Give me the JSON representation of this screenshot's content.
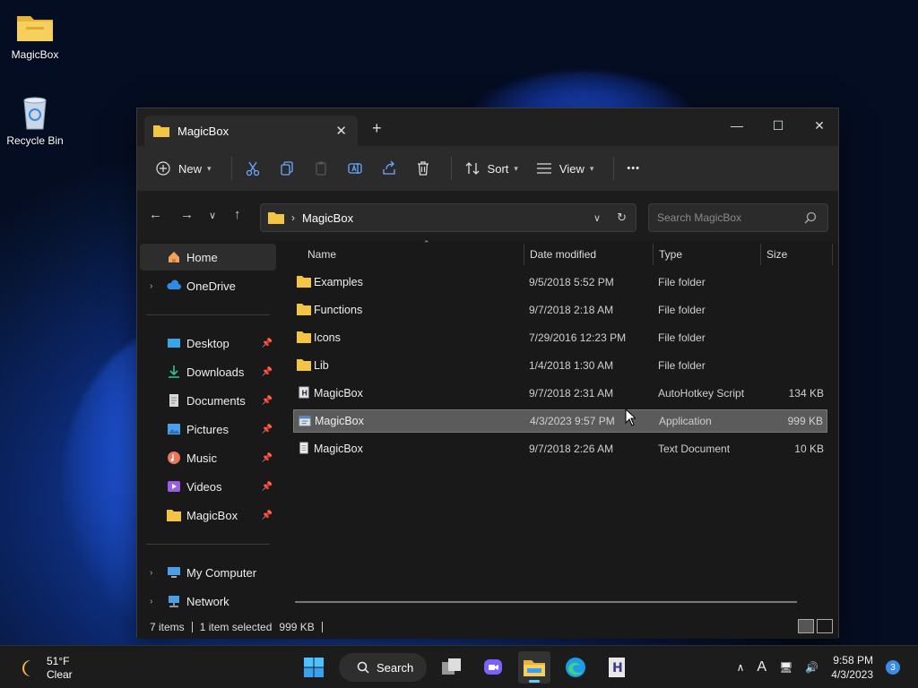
{
  "desktop": {
    "icons": [
      {
        "label": "MagicBox",
        "icon": "folder-icon"
      },
      {
        "label": "Recycle Bin",
        "icon": "recycle-bin-icon"
      }
    ]
  },
  "window": {
    "tab_title": "MagicBox",
    "controls": {
      "minimize": "—",
      "maximize": "☐",
      "close": "✕"
    },
    "new_tab": "+",
    "tab_close": "✕"
  },
  "toolbar": {
    "new_label": "New",
    "sort_label": "Sort",
    "view_label": "View",
    "more": "•••"
  },
  "address": {
    "path": "MagicBox",
    "separator": "›",
    "search_placeholder": "Search MagicBox"
  },
  "sidebar": {
    "items": [
      {
        "label": "Home",
        "icon": "home-icon"
      },
      {
        "label": "OneDrive",
        "icon": "cloud-icon"
      },
      {
        "label": "Desktop",
        "icon": "desktop-icon"
      },
      {
        "label": "Downloads",
        "icon": "download-icon"
      },
      {
        "label": "Documents",
        "icon": "document-icon"
      },
      {
        "label": "Pictures",
        "icon": "picture-icon"
      },
      {
        "label": "Music",
        "icon": "music-icon"
      },
      {
        "label": "Videos",
        "icon": "video-icon"
      },
      {
        "label": "MagicBox",
        "icon": "folder-icon"
      },
      {
        "label": "My Computer",
        "icon": "computer-icon"
      },
      {
        "label": "Network",
        "icon": "network-icon"
      }
    ]
  },
  "columns": {
    "name": "Name",
    "date": "Date modified",
    "type": "Type",
    "size": "Size"
  },
  "files": [
    {
      "name": "Examples",
      "date": "9/5/2018 5:52 PM",
      "type": "File folder",
      "size": "",
      "icon": "folder-icon"
    },
    {
      "name": "Functions",
      "date": "9/7/2018 2:18 AM",
      "type": "File folder",
      "size": "",
      "icon": "folder-icon"
    },
    {
      "name": "Icons",
      "date": "7/29/2016 12:23 PM",
      "type": "File folder",
      "size": "",
      "icon": "folder-icon"
    },
    {
      "name": "Lib",
      "date": "1/4/2018 1:30 AM",
      "type": "File folder",
      "size": "",
      "icon": "folder-icon"
    },
    {
      "name": "MagicBox",
      "date": "9/7/2018 2:31 AM",
      "type": "AutoHotkey Script",
      "size": "134 KB",
      "icon": "script-icon"
    },
    {
      "name": "MagicBox",
      "date": "4/3/2023 9:57 PM",
      "type": "Application",
      "size": "999 KB",
      "icon": "application-icon"
    },
    {
      "name": "MagicBox",
      "date": "9/7/2018 2:26 AM",
      "type": "Text Document",
      "size": "10 KB",
      "icon": "text-document-icon"
    }
  ],
  "status": {
    "items": "7 items",
    "selected": "1 item selected",
    "size": "999 KB"
  },
  "taskbar": {
    "weather_temp": "51°F",
    "weather_desc": "Clear",
    "search_label": "Search",
    "time": "9:58 PM",
    "date": "4/3/2023",
    "notifications": "3"
  },
  "colors": {
    "accent": "#60cdff",
    "selected_row": "#5b5b5b",
    "folder": "#f4c542"
  }
}
